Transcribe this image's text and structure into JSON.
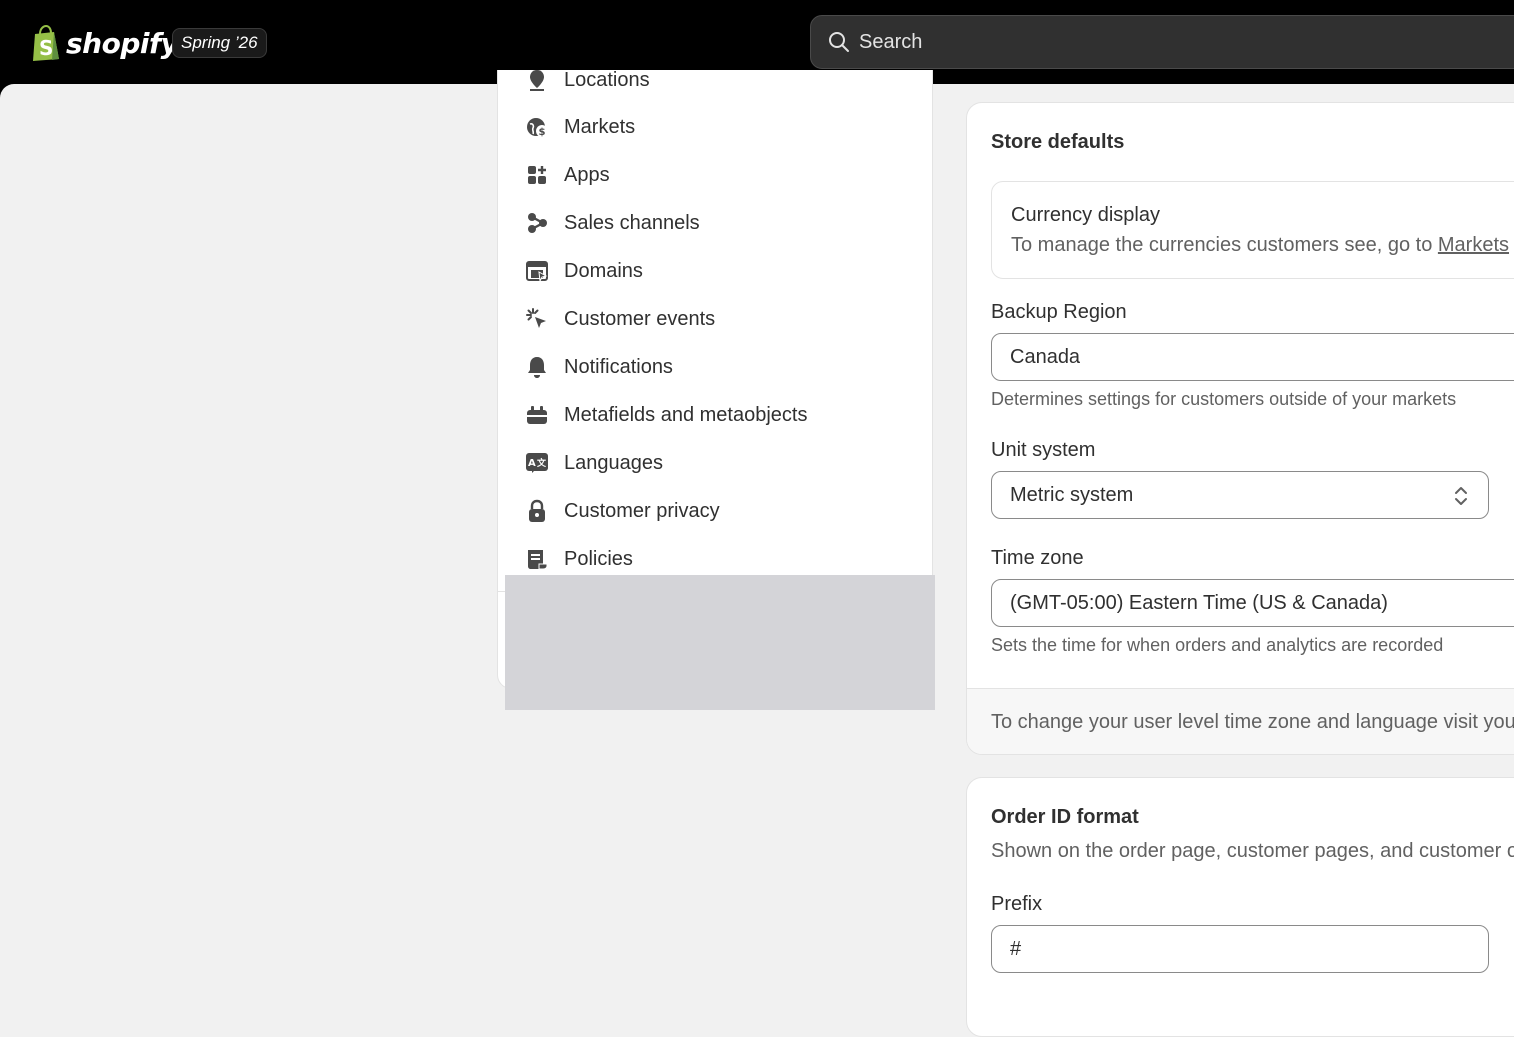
{
  "topbar": {
    "brand": "shopify",
    "release_badge": "Spring ’26",
    "search_placeholder": "Search"
  },
  "settings_nav": {
    "partial_item": "Locations",
    "items": [
      {
        "label": "Markets",
        "icon": "globe-dollar-icon"
      },
      {
        "label": "Apps",
        "icon": "apps-icon"
      },
      {
        "label": "Sales channels",
        "icon": "sales-channels-icon"
      },
      {
        "label": "Domains",
        "icon": "domains-icon"
      },
      {
        "label": "Customer events",
        "icon": "cursor-click-icon"
      },
      {
        "label": "Notifications",
        "icon": "bell-icon"
      },
      {
        "label": "Metafields and metaobjects",
        "icon": "metafields-icon"
      },
      {
        "label": "Languages",
        "icon": "translate-icon"
      },
      {
        "label": "Customer privacy",
        "icon": "lock-icon"
      },
      {
        "label": "Policies",
        "icon": "policy-scroll-icon"
      }
    ]
  },
  "store_defaults": {
    "title": "Store defaults",
    "currency_display": {
      "heading": "Currency display",
      "description": "To manage the currencies customers see, go to ",
      "link": "Markets"
    },
    "backup_region": {
      "label": "Backup Region",
      "value": "Canada",
      "help": "Determines settings for customers outside of your markets"
    },
    "unit_system": {
      "label": "Unit system",
      "value": "Metric system"
    },
    "time_zone": {
      "label": "Time zone",
      "value": "(GMT-05:00) Eastern Time (US & Canada)",
      "help": "Sets the time for when orders and analytics are recorded"
    },
    "footer_text": "To change your user level time zone and language visit your account settings"
  },
  "order_id": {
    "title": "Order ID format",
    "description": "Shown on the order page, customer pages, and customer order notifications",
    "prefix_label": "Prefix",
    "prefix_value": "#"
  },
  "colors": {
    "topbar": "#000000",
    "background": "#f1f1f1",
    "card": "#ffffff",
    "overlay": "#d4d4d8"
  }
}
